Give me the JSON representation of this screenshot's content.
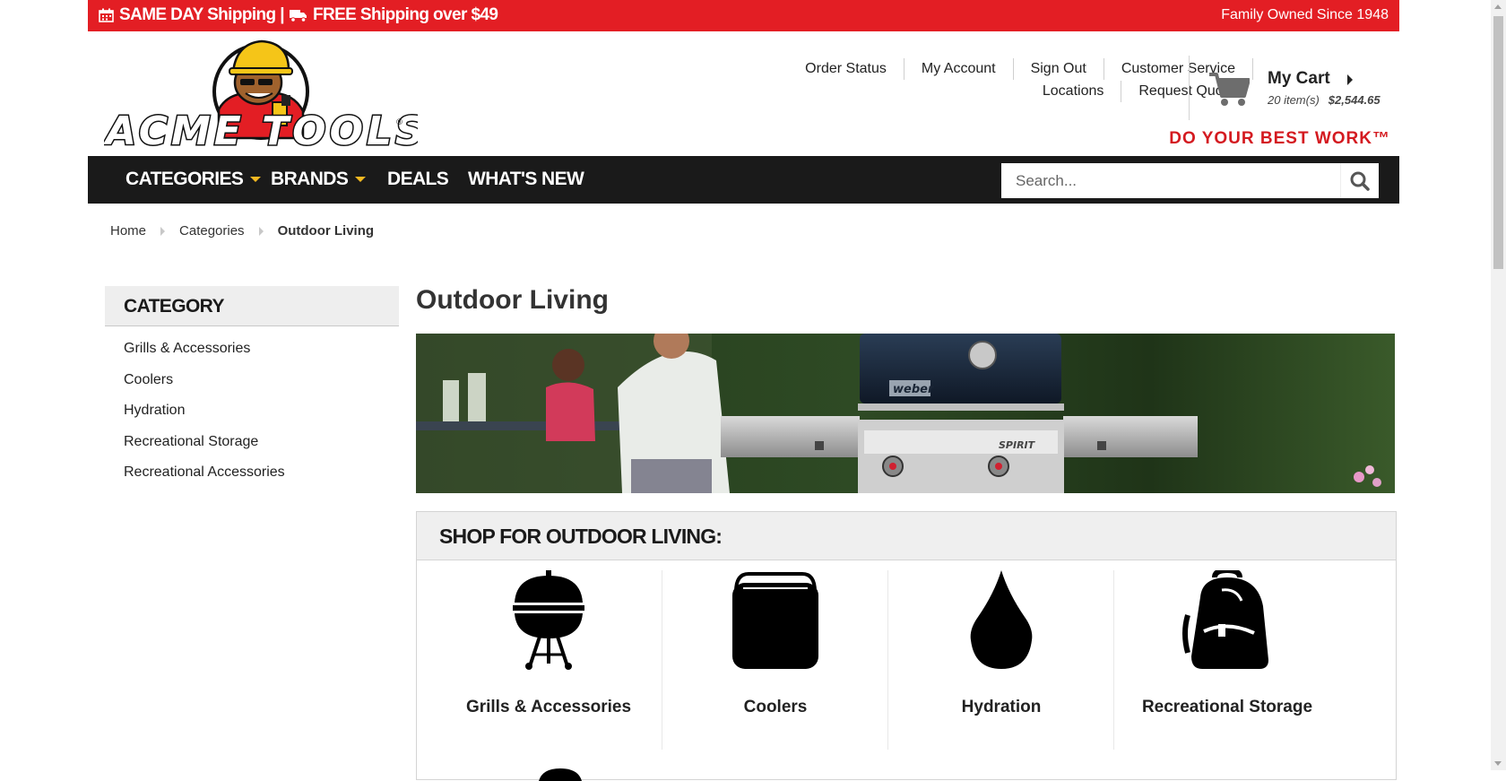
{
  "topbar": {
    "promo_a": "SAME DAY Shipping |",
    "promo_b": "FREE Shipping over $49",
    "since": "Family Owned Since 1948",
    "color": "#e31e24"
  },
  "header": {
    "logo_text": "ACME TOOLS",
    "links_row1": [
      "Order Status",
      "My Account",
      "Sign Out",
      "Customer Service"
    ],
    "links_row2": [
      "Locations",
      "Request Quote"
    ],
    "cart": {
      "title": "My Cart",
      "items": "20 item(s)",
      "total": "$2,544.65"
    },
    "tagline": "DO YOUR BEST WORK™"
  },
  "nav": {
    "categories": "CATEGORIES",
    "brands": "BRANDS",
    "deals": "DEALS",
    "whats_new": "WHAT'S NEW",
    "search_placeholder": "Search...",
    "caret_color": "#f5b921"
  },
  "breadcrumb": [
    "Home",
    "Categories",
    "Outdoor Living"
  ],
  "sidebar": {
    "title": "CATEGORY",
    "items": [
      "Grills & Accessories",
      "Coolers",
      "Hydration",
      "Recreational Storage",
      "Recreational Accessories"
    ]
  },
  "main": {
    "title": "Outdoor Living",
    "hero_brand": "weber",
    "hero_model": "SPIRIT",
    "shop_heading": "SHOP FOR OUTDOOR LIVING:",
    "tiles": [
      {
        "label": "Grills & Accessories",
        "icon": "grill-icon"
      },
      {
        "label": "Coolers",
        "icon": "cooler-icon"
      },
      {
        "label": "Hydration",
        "icon": "water-drop-icon"
      },
      {
        "label": "Recreational Storage",
        "icon": "backpack-icon"
      }
    ]
  }
}
